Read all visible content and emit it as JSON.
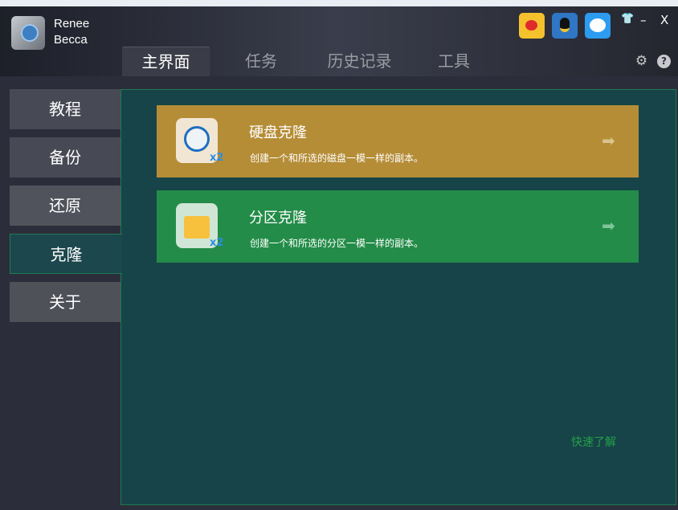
{
  "app": {
    "brand_line1": "Renee",
    "brand_line2": "Becca"
  },
  "header": {
    "social": [
      "weibo-icon",
      "qq-icon",
      "chat-icon"
    ],
    "tabs": [
      "主界面",
      "任务",
      "历史记录",
      "工具"
    ],
    "active_tab": "主界面"
  },
  "sidebar": {
    "items": [
      "教程",
      "备份",
      "还原",
      "克隆",
      "关于"
    ],
    "active": "克隆"
  },
  "cards": [
    {
      "title": "硬盘克隆",
      "desc": "创建一个和所选的磁盘一模一样的副本。",
      "badge": "x2",
      "color": "#b58d37"
    },
    {
      "title": "分区克隆",
      "desc": "创建一个和所选的分区一模一样的副本。",
      "badge": "x2",
      "color": "#238c48"
    }
  ],
  "quick_link": "快速了解",
  "window": {
    "skin": "shirt-icon",
    "minimize": "–",
    "close": "X"
  }
}
